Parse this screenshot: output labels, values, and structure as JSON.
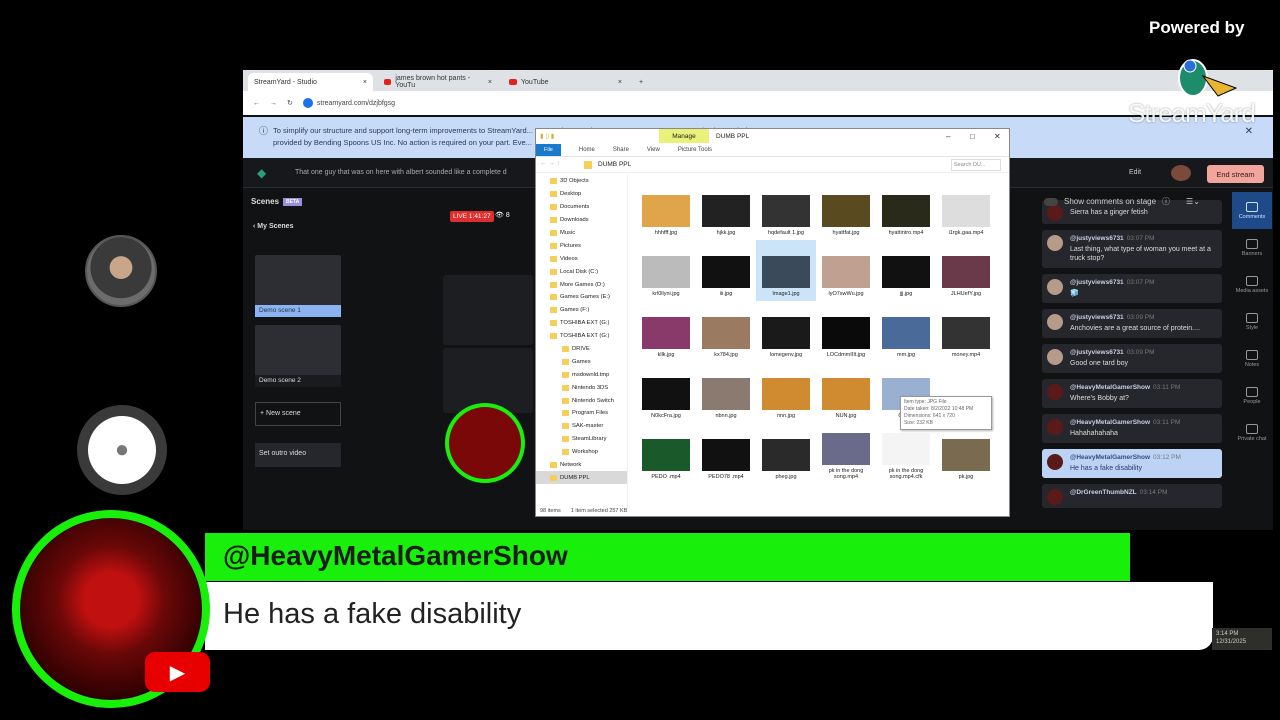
{
  "overlay": {
    "powered_by": "Powered by",
    "brand": "StreamYard",
    "lower_third": {
      "handle": "@HeavyMetalGamerShow",
      "message": "He has a fake disability"
    }
  },
  "browser": {
    "tabs": [
      {
        "label": "StreamYard - Studio"
      },
      {
        "label": "james brown hot pants - YouTu"
      },
      {
        "label": "YouTube"
      }
    ],
    "new_tab": "+",
    "url": "streamyard.com/dzjbfgsg",
    "banner": {
      "line1": "To simplify our structure and support long-term improvements to StreamYard... means that, starting on January 1, 2026, your service is now being",
      "line2": "provided by Bending Spoons US Inc. No action is required on your part. Eve..."
    }
  },
  "studio": {
    "marquee": "That one guy that was on here with albert sounded like a complete d",
    "edit_label": "Edit",
    "end_stream_label": "End stream",
    "scenes_title": "Scenes",
    "beta": "BETA",
    "my_scenes": "My Scenes",
    "scenes": [
      "Demo scene 1",
      "Demo scene 2"
    ],
    "new_scene": "New scene",
    "outro": "Set outro video",
    "live": "LIVE 1:41:27",
    "viewers": "8"
  },
  "explorer": {
    "manage": "Manage",
    "title": "DUMB PPL",
    "ribbon": [
      "File",
      "Home",
      "Share",
      "View",
      "Picture Tools"
    ],
    "path": "DUMB PPL",
    "search_placeholder": "Search DU...",
    "nav": [
      "3D Objects",
      "Desktop",
      "Documents",
      "Downloads",
      "Music",
      "Pictures",
      "Videos",
      "Local Disk (C:)",
      "More Games (D:)",
      "Games Games (E:)",
      "Games (F:)",
      "TOSHIBA EXT (G:)",
      "TOSHIBA EXT (G:)",
      "DRIVE",
      "Games",
      "msdownld.tmp",
      "Nintendo 3DS",
      "Nintendo Switch",
      "Program Files",
      "SAK-master",
      "SteamLibrary",
      "Workshop",
      "Network",
      "DUMB PPL"
    ],
    "files": [
      "hhhfff.jpg",
      "hjkk.jpg",
      "hqdefault 1.jpg",
      "hyattfat.jpg",
      "hyattintro.mp4",
      "i1rgk.gaa.mp4",
      "krl0llyni.jpg",
      "iii.jpg",
      "Image1.jpg",
      "lyO7swWu.jpg",
      "jjj.jpg",
      "JLHUefY.jpg",
      "kllk.jpg",
      "kx784.jpg",
      "lomegenv.jpg",
      "LOCdmmIIIt.jpg",
      "mm.jpg",
      "money.mp4",
      "N0kcFra.jpg",
      "nbnn.jpg",
      "nnn.jpg",
      "NUN.jpg",
      "OF8...",
      "",
      "PEDO .mp4",
      "PEDO78 .mp4",
      "pheg.jpg",
      "pk in the dong song.mp4",
      "pk in the dong song.mp4.cfk",
      "pk.jpg"
    ],
    "selected_index": 8,
    "tooltip": [
      "Item type: JPG File",
      "Date taken: 8/2/2022 10:48 PM",
      "Dimensions: 641 x 720",
      "Size: 232 KB"
    ],
    "status": {
      "count": "98 items",
      "selected": "1 item selected  257 KB"
    }
  },
  "comments": {
    "header": "Show comments on stage",
    "items": [
      {
        "author": "",
        "time": "",
        "text": "Sierra has a ginger fetish"
      },
      {
        "author": "@justyviews6731",
        "time": "03:07 PM",
        "text": "Last thing, what type of woman you meet at a truck stop?"
      },
      {
        "author": "@justyviews6731",
        "time": "03:07 PM",
        "text": "🧊"
      },
      {
        "author": "@justyviews6731",
        "time": "03:09 PM",
        "text": "Anchovies are a great source of protein...."
      },
      {
        "author": "@justyviews6731",
        "time": "03:09 PM",
        "text": "Good one tard boy"
      },
      {
        "author": "@HeavyMetalGamerShow",
        "time": "03:11 PM",
        "text": "Where's Bobby at?"
      },
      {
        "author": "@HeavyMetalGamerShow",
        "time": "03:11 PM",
        "text": "Hahahahahaha"
      },
      {
        "author": "@HeavyMetalGamerShow",
        "time": "03:12 PM",
        "text": "He has a fake disability",
        "highlighted": true
      },
      {
        "author": "@DrGreenThumbNZL",
        "time": "03:14 PM",
        "text": ""
      }
    ],
    "side": [
      "Comments",
      "Banners",
      "Media assets",
      "Style",
      "Notes",
      "People",
      "Private chat"
    ]
  },
  "taskbar": {
    "time": "3:14 PM",
    "date": "12/31/2025"
  }
}
